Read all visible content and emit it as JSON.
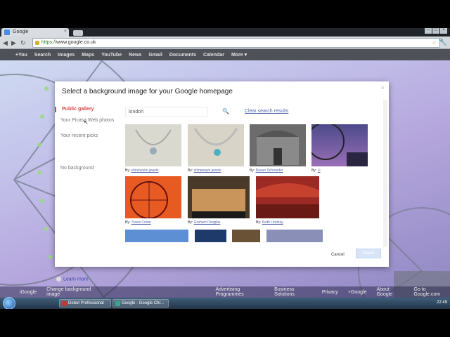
{
  "browser": {
    "tab_title": "Google",
    "url_scheme": "https://",
    "url_rest": "www.google.co.uk"
  },
  "gbar": [
    "+You",
    "Search",
    "Images",
    "Maps",
    "YouTube",
    "News",
    "Gmail",
    "Documents",
    "Calendar",
    "More ▾"
  ],
  "modal": {
    "title": "Select a background image for your Google homepage",
    "nav": {
      "public_gallery": "Public gallery",
      "picasa": "Your Picasa Web photos",
      "recent": "Your recent picks",
      "no_background": "No background",
      "learn_more": "Learn more"
    },
    "search_value": "london",
    "clear_link": "Clear search results",
    "images": [
      {
        "credit_prefix": "By:",
        "credit": "shinewave jewels",
        "color": "#d9d9cf"
      },
      {
        "credit_prefix": "By:",
        "credit": "shinewave jewels",
        "color": "#d8d4c7"
      },
      {
        "credit_prefix": "By:",
        "credit": "Rasuo Schroeder",
        "color": "#6c6c6c"
      },
      {
        "credit_prefix": "By:",
        "credit": "Li",
        "color": "#6b5fa8"
      },
      {
        "credit_prefix": "By:",
        "credit": "Travis Coote",
        "color": "#e75b22"
      },
      {
        "credit_prefix": "By:",
        "credit": "Graham Douglas",
        "color": "#4a3a2a"
      },
      {
        "credit_prefix": "By:",
        "credit": "Keith Lindsay",
        "color": "#9b2a24"
      }
    ],
    "cancel_label": "Cancel",
    "select_label": "Select"
  },
  "footer": [
    "iGoogle",
    "Change background image",
    "Advertising Programmes",
    "Business Solutions",
    "Privacy",
    "+Google",
    "About Google",
    "Go to Google.com"
  ],
  "taskbar": {
    "items": [
      "Debut Professional",
      "Google - Google Chr..."
    ],
    "clock": "22:49"
  }
}
